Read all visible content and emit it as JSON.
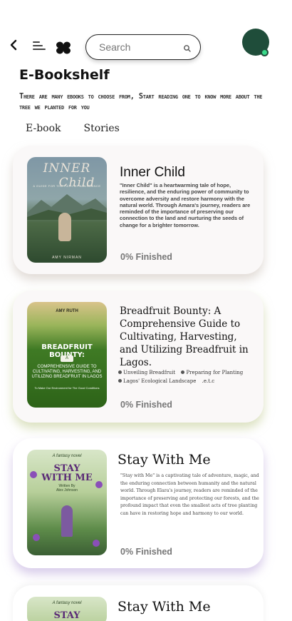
{
  "header": {
    "search_placeholder": "Search"
  },
  "page": {
    "title": "E-Bookshelf",
    "subtitle": "There are many ebooks to choose from, Start reading one to know more about the tree we planted for you"
  },
  "tabs": [
    {
      "label": "E-book"
    },
    {
      "label": "Stories"
    }
  ],
  "books": [
    {
      "title": "Inner Child",
      "description": "\"Inner Child\" is a heartwarming tale of hope, resilience, and the enduring power of community to overcome adversity and restore harmony with the natural world. Through Amara's journey, readers are reminded of the importance of preserving our connection to the land and nurturing the seeds of change for a brighter tomorrow.",
      "progress": "0% Finished",
      "cover": {
        "title_line1": "INNER",
        "title_line2": "Child",
        "subtitle": "A GUIDE FOR THE PATH OF ABUNDANCE",
        "author": "AMY NIRMAN"
      }
    },
    {
      "title": "Breadfruit Bounty: A Comprehensive Guide to Cultivating, Harvesting, and Utilizing Breadfruit in Lagos.",
      "tags": [
        "Unveiling Breadfruit",
        "Preparing for Planting",
        "Lagos' Ecological Landscape",
        ".e.t.c"
      ],
      "progress": "0% Finished",
      "cover": {
        "author": "AMY RUTH",
        "title": "BREADFRUIT BOUNTY:",
        "badge": "A",
        "subtitle": "COMPREHENSIVE GUIDE TO CULTIVATING, HARVESTING, AND UTILIZING BREADFRUIT IN LAGOS",
        "tagline": "To Make Our Environment for The Good Conditions"
      }
    },
    {
      "title": "Stay With Me",
      "description": "\"Stay with Me\" is a captivating tale of adventure, magic, and the enduring connection between humanity and the natural world. Through Elara's journey, readers are reminded of the importance of preserving and protecting our forests, and the profound impact that even the smallest acts of tree planting can have in restoring hope and harmony to our world.",
      "progress": "0% Finished",
      "cover": {
        "small": "A fantasy novel",
        "title_line1": "STAY",
        "title_line2": "WITH ME",
        "by": "Written By",
        "author": "Alex Johnson"
      }
    },
    {
      "title": "Stay With Me",
      "cover": {
        "small": "A fantasy novel",
        "title_line1": "STAY"
      }
    }
  ],
  "colors": {
    "avatar": "#1f4d3a",
    "online": "#3ad98a",
    "progress_text": "#777777"
  },
  "icons": {
    "back": "back-arrow-icon",
    "menu": "menu-icon",
    "logo": "app-logo-icon",
    "search": "search-icon"
  }
}
